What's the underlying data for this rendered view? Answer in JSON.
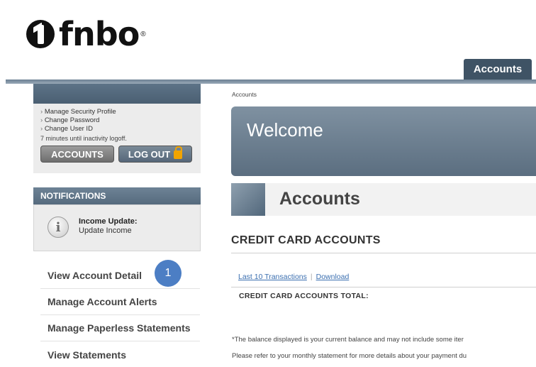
{
  "logo": {
    "text": "fnbo",
    "reg": "®"
  },
  "top_nav": {
    "accounts_tab": "Accounts"
  },
  "user_panel": {
    "links": [
      "Manage Security Profile",
      "Change Password",
      "Change User ID"
    ],
    "inactivity_text": "7 minutes until inactivity logoff.",
    "accounts_button": "ACCOUNTS",
    "logout_button": "LOG OUT"
  },
  "notifications": {
    "header": "NOTIFICATIONS",
    "item_title": "Income Update:",
    "item_text": "Update Income",
    "icon": "info-icon"
  },
  "side_nav": {
    "items": [
      "View Account Detail",
      "Manage Account Alerts",
      "Manage Paperless Statements",
      "View Statements"
    ]
  },
  "step_badge": "1",
  "main": {
    "breadcrumb": "Accounts",
    "welcome": "Welcome",
    "accounts_title": "Accounts",
    "cc_title": "CREDIT CARD ACCOUNTS",
    "link_transactions": "Last 10 Transactions",
    "link_download": "Download",
    "link_separator": "|",
    "total_label": "CREDIT CARD ACCOUNTS TOTAL:",
    "footnote_1": "*The balance displayed is your current balance and may not include some iter",
    "footnote_2": "Please refer to your monthly statement for more details about your payment du"
  },
  "colors": {
    "header_blue": "#3f5365",
    "panel_grey": "#ececec",
    "badge_blue": "#4c7ec4",
    "link_blue": "#3b6fb0",
    "lock_orange": "#f2a400"
  }
}
